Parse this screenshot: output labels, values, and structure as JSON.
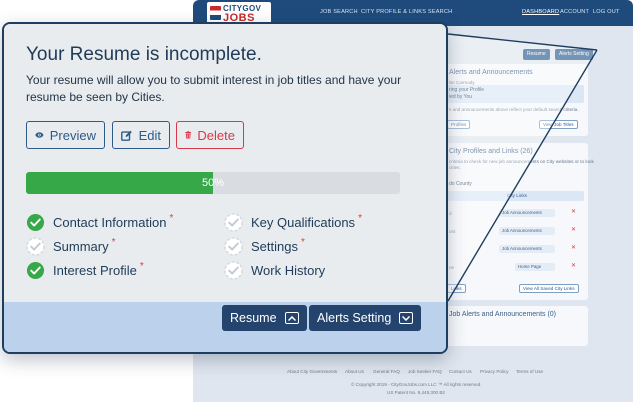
{
  "colors": {
    "primary": "#2d5a88",
    "danger": "#d9384a",
    "success": "#37a848",
    "header_navy": "#1f4b7c"
  },
  "background": {
    "logo": {
      "top": "CITYGOV",
      "bottom": "JOBS"
    },
    "nav": {
      "job_search": "JOB SEARCH",
      "city_profile_links": "CITY PROFILE & LINKS SEARCH",
      "dashboard": "DASHBOARD",
      "account": "ACCOUNT",
      "logout": "LOG OUT"
    },
    "mini_tabs": {
      "resume": "Resume",
      "alerts": "Alerts Setting"
    },
    "alerts_card": {
      "title": "Alerts and Announcements",
      "line1": "Be Carmody",
      "highlight_line1": "ring your Profile",
      "highlight_line2": "ied by You",
      "line2": "s and announcements above reflect your default search criteria.",
      "profile_button": "Profiles",
      "view_jobs_button": "View Job Titles"
    },
    "links_card": {
      "title": "City Profiles and Links (26)",
      "desc1": "criteria to check for new job announcements on City websites or to look",
      "desc2": "cities.",
      "county": "do County",
      "col_header": "City Links",
      "rows": [
        {
          "label": "d",
          "select": "Job Announcements"
        },
        {
          "label": "ont",
          "select": "Job Announcements"
        },
        {
          "label": "",
          "select": "Job Announcements"
        },
        {
          "label": "ne",
          "select": "Home Page"
        }
      ],
      "saved_links_button": "View All Saved City Links",
      "links_button": "Links"
    },
    "job_alerts_card": {
      "title": "Job Alerts and Announcements (0)"
    },
    "footer": {
      "links": [
        "About City Governments",
        "About Us",
        "General FAQ",
        "Job Seeker FAQ",
        "Contact Us",
        "Privacy Policy",
        "Terms of Use"
      ],
      "copyright": "© Copyright 2019 - CityGovJobs.com LLC ™ All rights reserved.",
      "patent": "US Patent No. 9,449,300 B2"
    }
  },
  "modal": {
    "title": "Your Resume is incomplete.",
    "description": "Your resume will allow you to submit interest in job titles and have your resume be seen by Cities.",
    "buttons": {
      "preview": {
        "label": "Preview",
        "icon": "eye-icon"
      },
      "edit": {
        "label": "Edit",
        "icon": "edit-icon"
      },
      "delete": {
        "label": "Delete",
        "icon": "trash-icon"
      }
    },
    "progress": {
      "percent": 50,
      "label": "50%"
    },
    "checklist": [
      {
        "label": "Contact Information",
        "done": true,
        "required": true
      },
      {
        "label": "Summary",
        "done": false,
        "required": true
      },
      {
        "label": "Interest Profile",
        "done": true,
        "required": true
      },
      {
        "label": "Key Qualifications",
        "done": false,
        "required": true
      },
      {
        "label": "Settings",
        "done": false,
        "required": true
      },
      {
        "label": "Work History",
        "done": false,
        "required": false
      }
    ],
    "footer_tabs": {
      "resume": {
        "label": "Resume",
        "icon": "chevron-up-icon"
      },
      "alerts_setting": {
        "label": "Alerts Setting",
        "icon": "chevron-down-icon"
      }
    }
  }
}
